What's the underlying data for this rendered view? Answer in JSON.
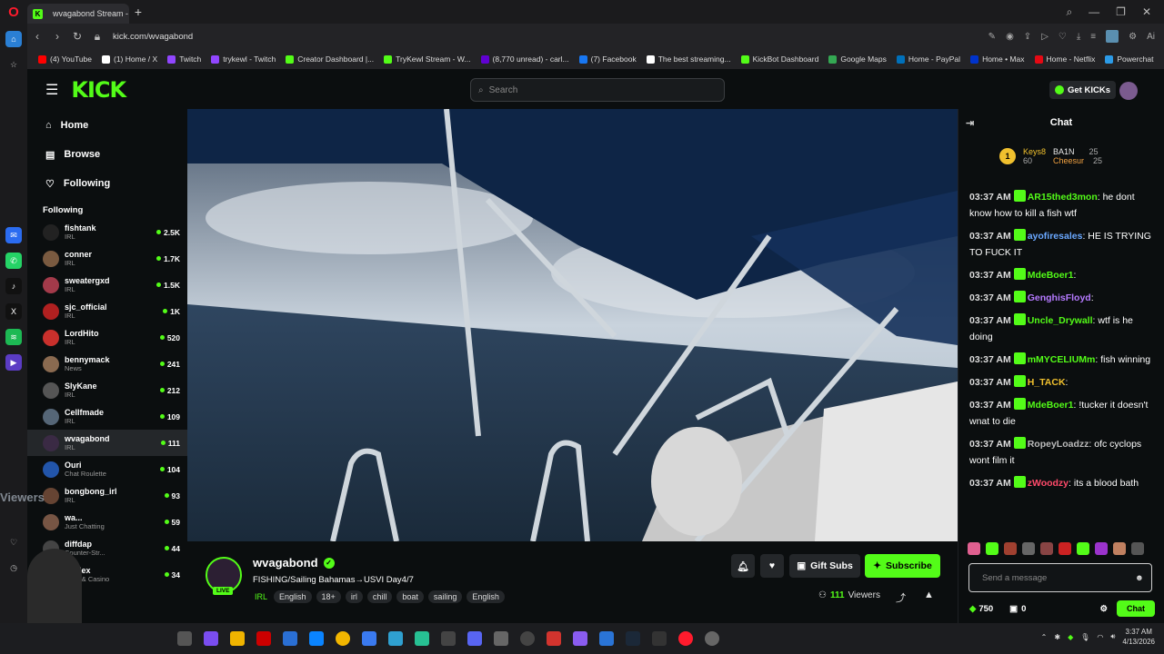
{
  "browser": {
    "tab_title": "wvagabond Stream - ",
    "url": "kick.com/wvagabond",
    "bookmarks": [
      {
        "label": "(4) YouTube",
        "color": "#ff0000"
      },
      {
        "label": "(1) Home / X",
        "color": "#ffffff"
      },
      {
        "label": "Twitch",
        "color": "#9146ff"
      },
      {
        "label": "trykewl - Twitch",
        "color": "#9146ff"
      },
      {
        "label": "Creator Dashboard |...",
        "color": "#53fc18"
      },
      {
        "label": "TryKewl Stream - W...",
        "color": "#53fc18"
      },
      {
        "label": "(8,770 unread) - carl...",
        "color": "#6001d2"
      },
      {
        "label": "(7) Facebook",
        "color": "#1877f2"
      },
      {
        "label": "The best streaming...",
        "color": "#ffffff"
      },
      {
        "label": "KickBot Dashboard",
        "color": "#53fc18"
      },
      {
        "label": "Google Maps",
        "color": "#34a853"
      },
      {
        "label": "Home - PayPal",
        "color": "#0070ba"
      },
      {
        "label": "Home • Max",
        "color": "#0033cc"
      },
      {
        "label": "Home - Netflix",
        "color": "#e50914"
      },
      {
        "label": "Powerchat",
        "color": "#2c9be7"
      }
    ]
  },
  "site": {
    "logo": "KICK",
    "search_placeholder": "Search",
    "get_kicks": "Get KICKs",
    "nav": [
      "Home",
      "Browse",
      "Following"
    ],
    "following_label": "Following",
    "following": [
      {
        "name": "fishtank",
        "cat": "IRL",
        "count": "2.5K",
        "color": "#222"
      },
      {
        "name": "conner",
        "cat": "IRL",
        "count": "1.7K",
        "color": "#7a5a40"
      },
      {
        "name": "sweatergxd",
        "cat": "IRL",
        "count": "1.5K",
        "color": "#a33a4a"
      },
      {
        "name": "sjc_official",
        "cat": "IRL",
        "count": "1K",
        "color": "#b02020"
      },
      {
        "name": "LordHito",
        "cat": "IRL",
        "count": "520",
        "color": "#c9302c"
      },
      {
        "name": "bennymack",
        "cat": "News",
        "count": "241",
        "color": "#8a6a50"
      },
      {
        "name": "SlyKane",
        "cat": "IRL",
        "count": "212",
        "color": "#555"
      },
      {
        "name": "Cellfmade",
        "cat": "IRL",
        "count": "109",
        "color": "#556677"
      },
      {
        "name": "wvagabond",
        "cat": "IRL",
        "count": "111",
        "color": "#3a2a44"
      },
      {
        "name": "Ouri",
        "cat": "Chat Roulette",
        "count": "104",
        "color": "#2255aa"
      },
      {
        "name": "bongbong_irl",
        "cat": "IRL",
        "count": "93",
        "color": "#664433"
      },
      {
        "name": "wa...",
        "cat": "Just Chatting",
        "count": "59",
        "color": "#775544"
      },
      {
        "name": "diffdap",
        "cat": "Counter-Str...",
        "count": "44",
        "color": "#444"
      },
      {
        "name": "soulex",
        "cat": "Slots & Casino",
        "count": "34",
        "color": "#663333"
      }
    ]
  },
  "stream": {
    "channel": "wvagabond",
    "live": "LIVE",
    "title": "FISHING/Sailing Bahamas→USVI Day4/7",
    "category": "IRL",
    "tags": [
      "English",
      "18+",
      "irl",
      "chill",
      "boat",
      "sailing",
      "English"
    ],
    "gift_subs": "Gift Subs",
    "subscribe": "Subscribe",
    "viewers_count": "111",
    "viewers_label": "Viewers"
  },
  "chat": {
    "title": "Chat",
    "leaders": [
      {
        "name": "Keys8",
        "count": "60",
        "color": "#f0c02e"
      },
      {
        "name": "BA1N",
        "count": "25",
        "color": "#dddddd"
      },
      {
        "name": "Cheesur",
        "count": "25",
        "color": "#f0a040"
      }
    ],
    "messages": [
      {
        "time": "03:37 AM",
        "user": "AR15thed3mon",
        "color": "#53fc18",
        "text": "he dont know how to kill a fish wtf"
      },
      {
        "time": "03:37 AM",
        "user": "ayofiresales",
        "color": "#6aa8ff",
        "text": "HE IS TRYING TO FUCK IT"
      },
      {
        "time": "03:37 AM",
        "user": "MdeBoer1",
        "color": "#53fc18",
        "text": ""
      },
      {
        "time": "03:37 AM",
        "user": "GenghisFloyd",
        "color": "#b57aff",
        "text": ""
      },
      {
        "time": "03:37 AM",
        "user": "Uncle_Drywall",
        "color": "#53fc18",
        "text": "wtf is he doing"
      },
      {
        "time": "03:37 AM",
        "user": "mMYCELIUMm",
        "color": "#53fc18",
        "text": "fish winning"
      },
      {
        "time": "03:37 AM",
        "user": "H_TACK",
        "color": "#f0c02e",
        "text": ""
      },
      {
        "time": "03:37 AM",
        "user": "MdeBoer1",
        "color": "#53fc18",
        "text": "!tucker it doesn't wnat to die"
      },
      {
        "time": "03:37 AM",
        "user": "RopeyLoadzz",
        "color": "#bbbbbb",
        "text": "ofc cyclops wont film it"
      },
      {
        "time": "03:37 AM",
        "user": "zWoodzy",
        "color": "#ff4a6a",
        "text": "its a blood bath"
      }
    ],
    "placeholder": "Send a message",
    "kicks": "750",
    "count": "0",
    "send": "Chat"
  },
  "overlay": {
    "text": "Viewers"
  },
  "taskbar": {
    "time": "3:37 AM",
    "date": "4/13/2026"
  }
}
